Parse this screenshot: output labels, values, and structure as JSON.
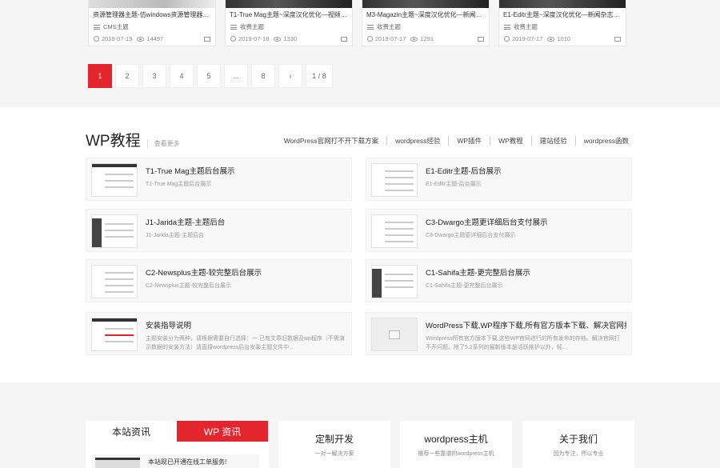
{
  "cards": [
    {
      "title": "资源管理器主题-仿windows资源管理器-wor...",
      "category": "CMS主题",
      "date": "2019-07-19",
      "views": "14497"
    },
    {
      "title": "T1-True Mag主题~深度汉化优化—视频播...",
      "category": "收费主题",
      "date": "2019-07-18",
      "views": "1330"
    },
    {
      "title": "M3-Magazin主题~深度汉化优化—新闻杂志...",
      "category": "收费主题",
      "date": "2019-07-17",
      "views": "1291"
    },
    {
      "title": "E1-Editr主题~深度汉化优化—新闻杂志wor...",
      "category": "收费主题",
      "date": "2019-07-17",
      "views": "1010"
    }
  ],
  "pagination": {
    "pages": [
      "1",
      "2",
      "3",
      "4",
      "5",
      "...",
      "8"
    ],
    "next": "›",
    "total": "1 / 8"
  },
  "wp_section": {
    "title": "WP教程",
    "more": "查看更多",
    "links": [
      "WordPress官网打不开下载方案",
      "wordpress经验",
      "WP插件",
      "WP教程",
      "建站经验",
      "wordpress函数"
    ]
  },
  "posts": [
    {
      "title": "T1-True Mag主题后台展示",
      "desc": "T1-True Mag主题后台展示"
    },
    {
      "title": "E1-Editr主题-后台展示",
      "desc": "E1-Editr主题-后台展示"
    },
    {
      "title": "J1-Jarida主题-主题后台",
      "desc": "J1-Jarida主题-主题后台"
    },
    {
      "title": "C3-Dwargo主题更详细后台支付展示",
      "desc": "C3-Dwargo主题更详细后台支付展示"
    },
    {
      "title": "C2-Newsplus主题-较完整后台展示",
      "desc": "C2-Newsplus主题-较完整后台展示"
    },
    {
      "title": "C1-Sahifa主题-更完整后台展示",
      "desc": "C1-Sahifa主题-更完整后台展示"
    },
    {
      "title": "安装指导说明",
      "desc": "主题安装分为两种，请根据需要自行选择：一.已有文章旧数据及wp程序（不需演示数据的安装方法）请直接wordpress后台安装主题文件中..."
    },
    {
      "title": "WordPress下载,WP程序下载,所有官方版本下载、解决官网打不开",
      "desc": "Wordpress所有官方版本下载,这些WP官网进行的所有发布的存档。解决官网打不开问题。除了5.2系列的最新版本是活跃维护以外，轻..."
    }
  ],
  "news": {
    "tab1": "本站资讯",
    "tab2": "WP 资讯",
    "item": "本站现已开通在线工单服务!"
  },
  "services": [
    {
      "title": "定制开发",
      "sub": "一对一解决方案"
    },
    {
      "title": "wordpress主机",
      "sub": "推荐一些靠谱的wordpress主机"
    },
    {
      "title": "关于我们",
      "sub": "因为专注，所以专业"
    }
  ],
  "colors": {
    "accent": "#e4252d"
  }
}
